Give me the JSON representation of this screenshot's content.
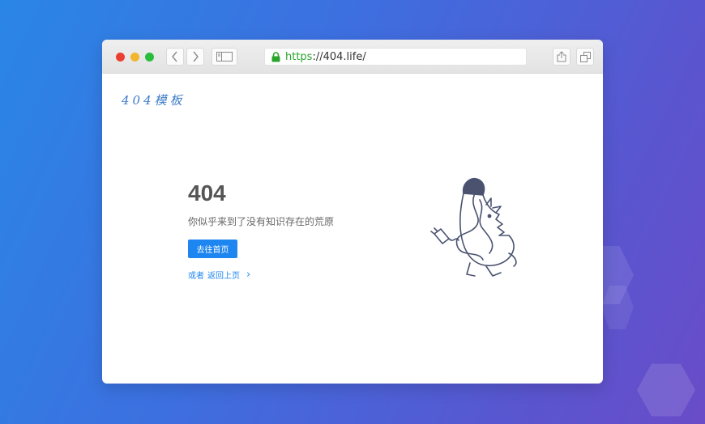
{
  "browser": {
    "url_scheme": "https",
    "url_rest": "://404.life/"
  },
  "page": {
    "logo_text": "404模板",
    "error_code": "404",
    "message": "你似乎来到了没有知识存在的荒原",
    "home_button": "去往首页",
    "back_prefix": "或者",
    "back_link": "返回上页",
    "back_arrow": "›"
  },
  "colors": {
    "accent": "#1e86f0",
    "lock": "#2aa52b",
    "title": "#555555",
    "text": "#666666",
    "illustration": "#4a5270"
  },
  "icons": {
    "close": "red-circle",
    "minimize": "yellow-circle",
    "zoom": "green-circle",
    "back": "chevron-left-icon",
    "forward": "chevron-right-icon",
    "sidebar": "sidebar-icon",
    "lock": "lock-icon",
    "share": "share-icon",
    "tabs": "tabs-icon"
  }
}
